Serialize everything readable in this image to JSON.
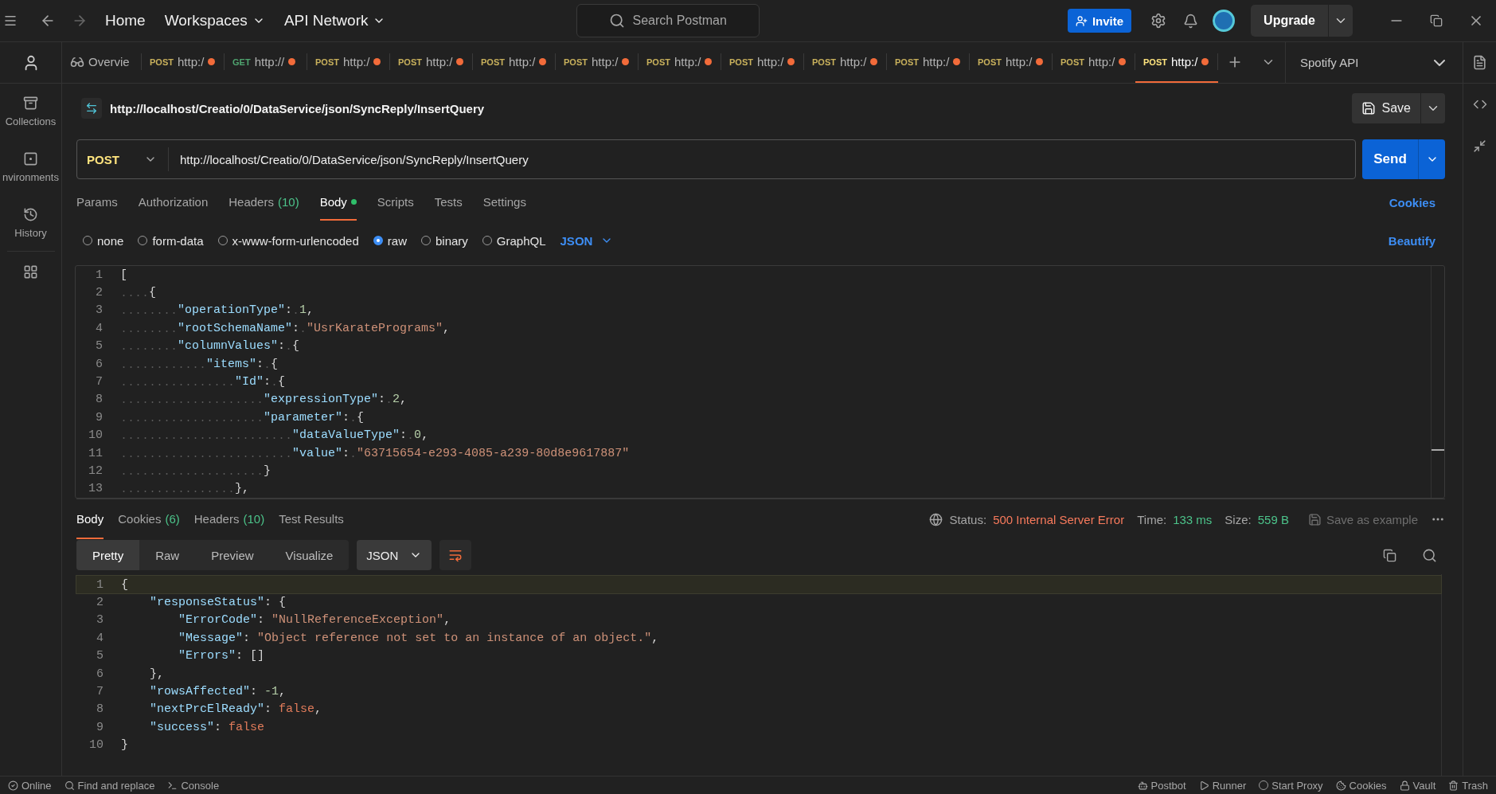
{
  "top_bar": {
    "nav": [
      {
        "label": "Home",
        "dropdown": false
      },
      {
        "label": "Workspaces",
        "dropdown": true
      },
      {
        "label": "API Network",
        "dropdown": true
      }
    ],
    "search": {
      "placeholder": "Search Postman"
    },
    "invite": "Invite",
    "upgrade": "Upgrade"
  },
  "sidebar": {
    "items": [
      {
        "label": "Collections"
      },
      {
        "label": "nvironments"
      },
      {
        "label": "History"
      }
    ]
  },
  "tabs": [
    {
      "kind": "overview",
      "label": "Overvie",
      "selected": false,
      "unsaved": false
    },
    {
      "kind": "post",
      "method": "POST",
      "label": "http:/",
      "selected": false,
      "unsaved": true
    },
    {
      "kind": "get",
      "method": "GET",
      "label": "http://",
      "selected": false,
      "unsaved": true
    },
    {
      "kind": "post",
      "method": "POST",
      "label": "http:/",
      "selected": false,
      "unsaved": true
    },
    {
      "kind": "post",
      "method": "POST",
      "label": "http:/",
      "selected": false,
      "unsaved": true
    },
    {
      "kind": "post",
      "method": "POST",
      "label": "http:/",
      "selected": false,
      "unsaved": true
    },
    {
      "kind": "post",
      "method": "POST",
      "label": "http:/",
      "selected": false,
      "unsaved": true
    },
    {
      "kind": "post",
      "method": "POST",
      "label": "http:/",
      "selected": false,
      "unsaved": true
    },
    {
      "kind": "post",
      "method": "POST",
      "label": "http:/",
      "selected": false,
      "unsaved": true
    },
    {
      "kind": "post",
      "method": "POST",
      "label": "http:/",
      "selected": false,
      "unsaved": true
    },
    {
      "kind": "post",
      "method": "POST",
      "label": "http:/",
      "selected": false,
      "unsaved": true
    },
    {
      "kind": "post",
      "method": "POST",
      "label": "http:/",
      "selected": false,
      "unsaved": true
    },
    {
      "kind": "post",
      "method": "POST",
      "label": "http:/",
      "selected": false,
      "unsaved": true
    },
    {
      "kind": "post",
      "method": "POST",
      "label": "http:/",
      "selected": true,
      "unsaved": true
    }
  ],
  "environment": "Spotify API",
  "request": {
    "title": "http://localhost/Creatio/0/DataService/json/SyncReply/InsertQuery",
    "save": "Save",
    "method": "POST",
    "url": "http://localhost/Creatio/0/DataService/json/SyncReply/InsertQuery",
    "send": "Send",
    "tabs": [
      {
        "label": "Params",
        "selected": false,
        "modified": false
      },
      {
        "label": "Authorization",
        "selected": false,
        "modified": false
      },
      {
        "label": "Headers",
        "count": "(10)",
        "selected": false,
        "modified": false
      },
      {
        "label": "Body",
        "selected": true,
        "modified": true
      },
      {
        "label": "Scripts",
        "selected": false,
        "modified": false
      },
      {
        "label": "Tests",
        "selected": false,
        "modified": false
      },
      {
        "label": "Settings",
        "selected": false,
        "modified": false
      }
    ],
    "cookies": "Cookies",
    "body_types": [
      {
        "label": "none",
        "selected": false
      },
      {
        "label": "form-data",
        "selected": false
      },
      {
        "label": "x-www-form-urlencoded",
        "selected": false
      },
      {
        "label": "raw",
        "selected": true
      },
      {
        "label": "binary",
        "selected": false
      },
      {
        "label": "GraphQL",
        "selected": false
      }
    ],
    "format": "JSON",
    "beautify": "Beautify",
    "editor": {
      "show_whitespace": true,
      "lines": [
        {
          "number": "1",
          "tokens": [
            {
              "kind": "punct",
              "text": "["
            }
          ]
        },
        {
          "number": "2",
          "tokens": [
            {
              "kind": "punct",
              "text": "    {"
            }
          ]
        },
        {
          "number": "3",
          "tokens": [
            {
              "kind": "key",
              "text": "        \"operationType\""
            },
            {
              "kind": "punct",
              "text": ": "
            },
            {
              "kind": "num",
              "text": "1"
            },
            {
              "kind": "punct",
              "text": ","
            }
          ]
        },
        {
          "number": "4",
          "tokens": [
            {
              "kind": "key",
              "text": "        \"rootSchemaName\""
            },
            {
              "kind": "punct",
              "text": ": "
            },
            {
              "kind": "str",
              "text": "\"UsrKaratePrograms\""
            },
            {
              "kind": "punct",
              "text": ","
            }
          ]
        },
        {
          "number": "5",
          "tokens": [
            {
              "kind": "key",
              "text": "        \"columnValues\""
            },
            {
              "kind": "punct",
              "text": ": {"
            }
          ]
        },
        {
          "number": "6",
          "tokens": [
            {
              "kind": "key",
              "text": "            \"items\""
            },
            {
              "kind": "punct",
              "text": ": {"
            }
          ]
        },
        {
          "number": "7",
          "tokens": [
            {
              "kind": "key",
              "text": "                \"Id\""
            },
            {
              "kind": "punct",
              "text": ": {"
            }
          ]
        },
        {
          "number": "8",
          "tokens": [
            {
              "kind": "key",
              "text": "                    \"expressionType\""
            },
            {
              "kind": "punct",
              "text": ": "
            },
            {
              "kind": "num",
              "text": "2"
            },
            {
              "kind": "punct",
              "text": ","
            }
          ]
        },
        {
          "number": "9",
          "tokens": [
            {
              "kind": "key",
              "text": "                    \"parameter\""
            },
            {
              "kind": "punct",
              "text": ": {"
            }
          ]
        },
        {
          "number": "10",
          "tokens": [
            {
              "kind": "key",
              "text": "                        \"dataValueType\""
            },
            {
              "kind": "punct",
              "text": ": "
            },
            {
              "kind": "num",
              "text": "0"
            },
            {
              "kind": "punct",
              "text": ","
            }
          ]
        },
        {
          "number": "11",
          "tokens": [
            {
              "kind": "key",
              "text": "                        \"value\""
            },
            {
              "kind": "punct",
              "text": ": "
            },
            {
              "kind": "str",
              "text": "\"63715654-e293-4085-a239-80d8e9617887\""
            }
          ]
        },
        {
          "number": "12",
          "tokens": [
            {
              "kind": "punct",
              "text": "                    }"
            }
          ]
        },
        {
          "number": "13",
          "tokens": [
            {
              "kind": "punct",
              "text": "                },"
            }
          ]
        }
      ]
    }
  },
  "response": {
    "tabs": [
      {
        "label": "Body",
        "selected": true
      },
      {
        "label": "Cookies",
        "count": "(6)",
        "selected": false
      },
      {
        "label": "Headers",
        "count": "(10)",
        "selected": false
      },
      {
        "label": "Test Results",
        "selected": false
      }
    ],
    "status_label": "Status:",
    "status": "500 Internal Server Error",
    "time_label": "Time:",
    "time": "133 ms",
    "size_label": "Size:",
    "size": "559 B",
    "save_example": "Save as example",
    "views": [
      {
        "label": "Pretty",
        "selected": true
      },
      {
        "label": "Raw",
        "selected": false
      },
      {
        "label": "Preview",
        "selected": false
      },
      {
        "label": "Visualize",
        "selected": false
      }
    ],
    "format": "JSON",
    "lines": [
      {
        "number": "1",
        "active": true,
        "tokens": [
          {
            "kind": "punct",
            "text": "{"
          }
        ]
      },
      {
        "number": "2",
        "active": false,
        "tokens": [
          {
            "kind": "key",
            "text": "    \"responseStatus\""
          },
          {
            "kind": "punct",
            "text": ": {"
          }
        ]
      },
      {
        "number": "3",
        "active": false,
        "tokens": [
          {
            "kind": "key",
            "text": "        \"ErrorCode\""
          },
          {
            "kind": "punct",
            "text": ": "
          },
          {
            "kind": "str",
            "text": "\"NullReferenceException\""
          },
          {
            "kind": "punct",
            "text": ","
          }
        ]
      },
      {
        "number": "4",
        "active": false,
        "tokens": [
          {
            "kind": "key",
            "text": "        \"Message\""
          },
          {
            "kind": "punct",
            "text": ": "
          },
          {
            "kind": "str",
            "text": "\"Object reference not set to an instance of an object.\""
          },
          {
            "kind": "punct",
            "text": ","
          }
        ]
      },
      {
        "number": "5",
        "active": false,
        "tokens": [
          {
            "kind": "key",
            "text": "        \"Errors\""
          },
          {
            "kind": "punct",
            "text": ": []"
          }
        ]
      },
      {
        "number": "6",
        "active": false,
        "tokens": [
          {
            "kind": "punct",
            "text": "    },"
          }
        ]
      },
      {
        "number": "7",
        "active": false,
        "tokens": [
          {
            "kind": "key",
            "text": "    \"rowsAffected\""
          },
          {
            "kind": "punct",
            "text": ": "
          },
          {
            "kind": "num",
            "text": "-1"
          },
          {
            "kind": "punct",
            "text": ","
          }
        ]
      },
      {
        "number": "8",
        "active": false,
        "tokens": [
          {
            "kind": "key",
            "text": "    \"nextPrcElReady\""
          },
          {
            "kind": "punct",
            "text": ": "
          },
          {
            "kind": "bool",
            "text": "false"
          },
          {
            "kind": "punct",
            "text": ","
          }
        ]
      },
      {
        "number": "9",
        "active": false,
        "tokens": [
          {
            "kind": "key",
            "text": "    \"success\""
          },
          {
            "kind": "punct",
            "text": ": "
          },
          {
            "kind": "bool",
            "text": "false"
          }
        ]
      },
      {
        "number": "10",
        "active": false,
        "tokens": [
          {
            "kind": "punct",
            "text": "}"
          }
        ]
      }
    ]
  },
  "status_bar": {
    "items": [
      {
        "label": "Online"
      },
      {
        "label": "Find and replace"
      },
      {
        "label": "Console"
      },
      {
        "label": "Postbot"
      },
      {
        "label": "Runner"
      },
      {
        "label": "Start Proxy"
      },
      {
        "label": "Cookies"
      },
      {
        "label": "Vault"
      },
      {
        "label": "Trash"
      }
    ]
  }
}
